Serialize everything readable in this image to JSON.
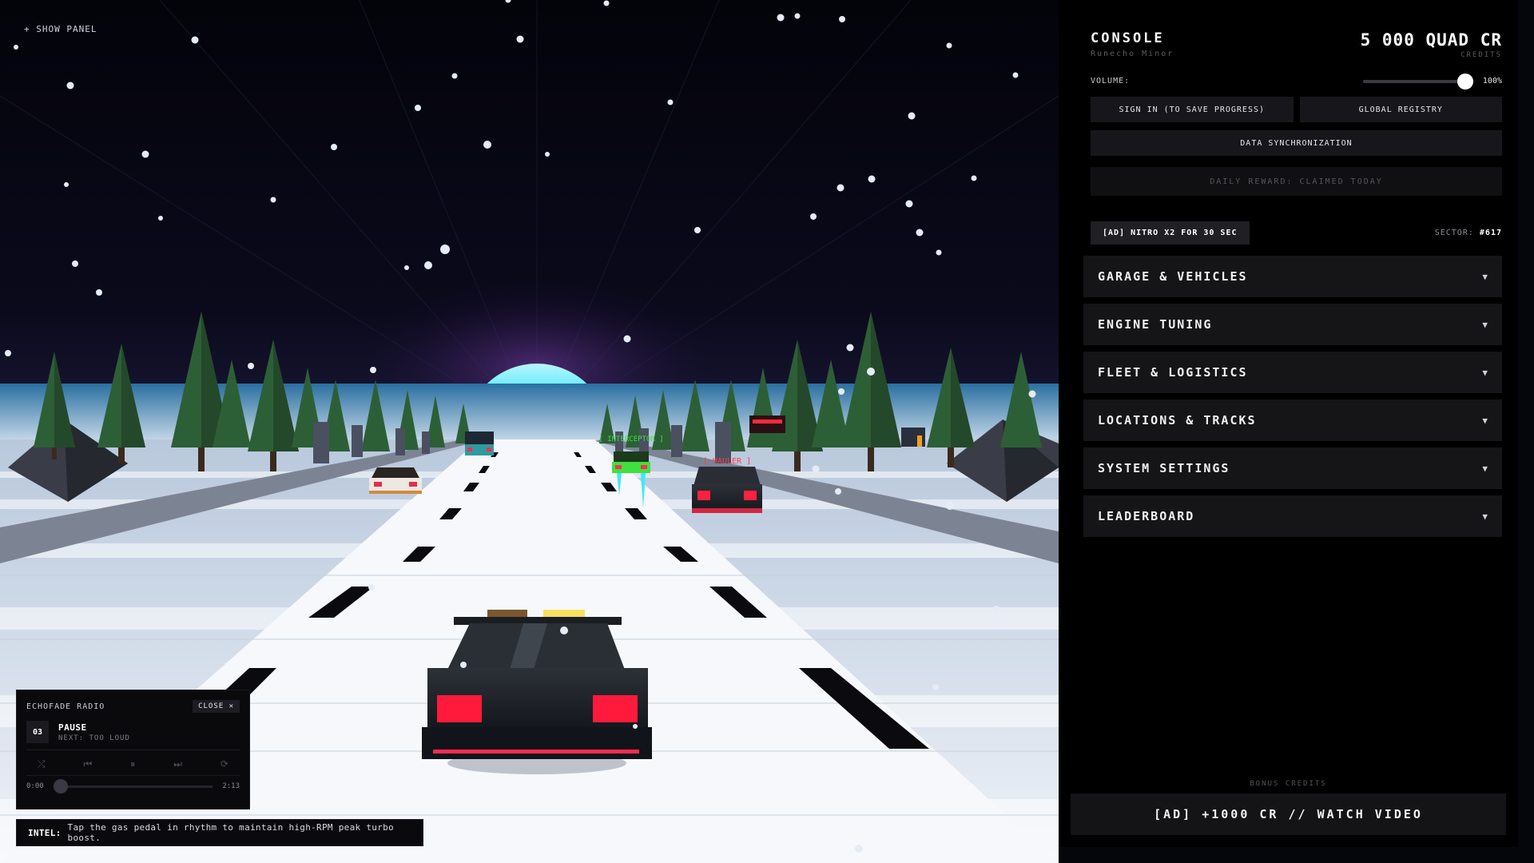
{
  "scene": {
    "show_panel_label": "+ SHOW PANEL",
    "npc_tags": [
      "[ INTERCEPTOR ]",
      "[ HAULER ]"
    ],
    "colors": {
      "sky": "#06060f",
      "sun": "#3fe6f7",
      "road": "#f3f5fa",
      "tree": "#2d5f36",
      "taillight": "#ff2040",
      "interceptor": "#3fe03f"
    }
  },
  "radio": {
    "title": "ECHOFADE RADIO",
    "close_label": "CLOSE ✕",
    "track_number": "03",
    "track_name": "PAUSE",
    "next_label": "NEXT: TOO LOUD",
    "controls": [
      "shuffle-icon",
      "prev-icon",
      "pause-icon",
      "next-icon",
      "repeat-icon"
    ],
    "time_current": "0:00",
    "time_total": "2:13"
  },
  "intel": {
    "label": "INTEL:",
    "text": "Tap the gas pedal in rhythm to maintain high-RPM peak turbo boost."
  },
  "panel": {
    "title": "CONSOLE",
    "subtitle": "Runecho Minor",
    "credits_value": "5 000 QUAD CR",
    "credits_label": "CREDITS",
    "volume_label": "VOLUME:",
    "volume_value": "100%",
    "volume_level": 1.0,
    "sign_in_label": "SIGN IN (TO SAVE PROGRESS)",
    "registry_label": "GLOBAL REGISTRY",
    "sync_label": "DATA SYNCHRONIZATION",
    "daily_reward_label": "DAILY REWARD: CLAIMED TODAY",
    "nitro_ad_label": "[AD] NITRO X2 FOR 30 SEC",
    "sector_label": "SECTOR:",
    "sector_value": "#617",
    "sections": [
      {
        "label": "GARAGE & VEHICLES"
      },
      {
        "label": "ENGINE TUNING"
      },
      {
        "label": "FLEET & LOGISTICS"
      },
      {
        "label": "LOCATIONS & TRACKS"
      },
      {
        "label": "SYSTEM SETTINGS"
      },
      {
        "label": "LEADERBOARD"
      }
    ],
    "caret": "▼",
    "bonus_label": "BONUS CREDITS",
    "bonus_button_label": "[AD] +1000 CR // WATCH VIDEO"
  }
}
